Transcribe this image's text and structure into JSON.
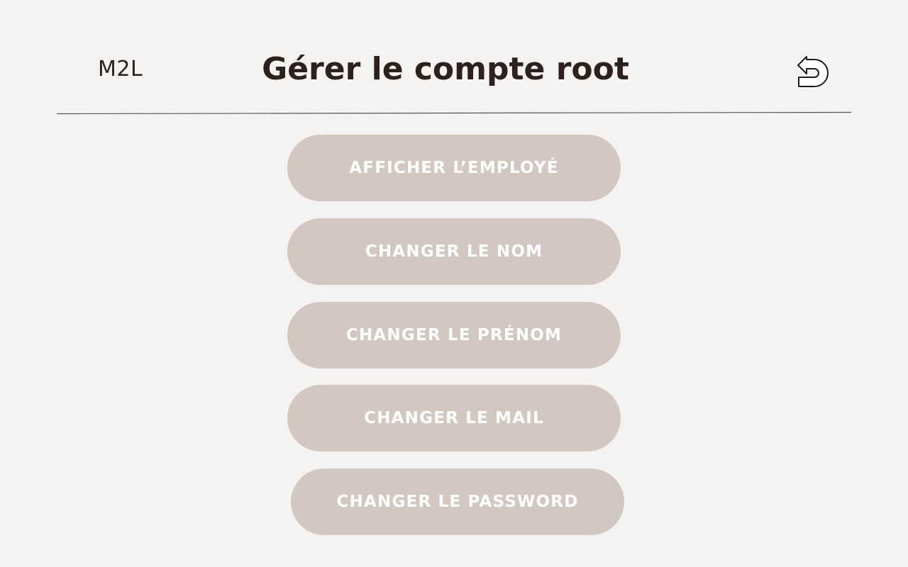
{
  "header": {
    "logo": "M2L",
    "title": "Gérer le compte root",
    "back_icon": "back-arrow-icon"
  },
  "menu": {
    "items": [
      {
        "label": "AFFICHER L’EMPLOYÉ"
      },
      {
        "label": "CHANGER LE NOM"
      },
      {
        "label": "CHANGER LE PRÉNOM"
      },
      {
        "label": "CHANGER LE MAIL"
      },
      {
        "label": "CHANGER LE PASSWORD"
      }
    ]
  },
  "colors": {
    "background": "#f4f3f1",
    "text": "#2d211d",
    "button_fill": "#d2c8c1",
    "button_text": "#ffffff",
    "divider": "#555555"
  }
}
